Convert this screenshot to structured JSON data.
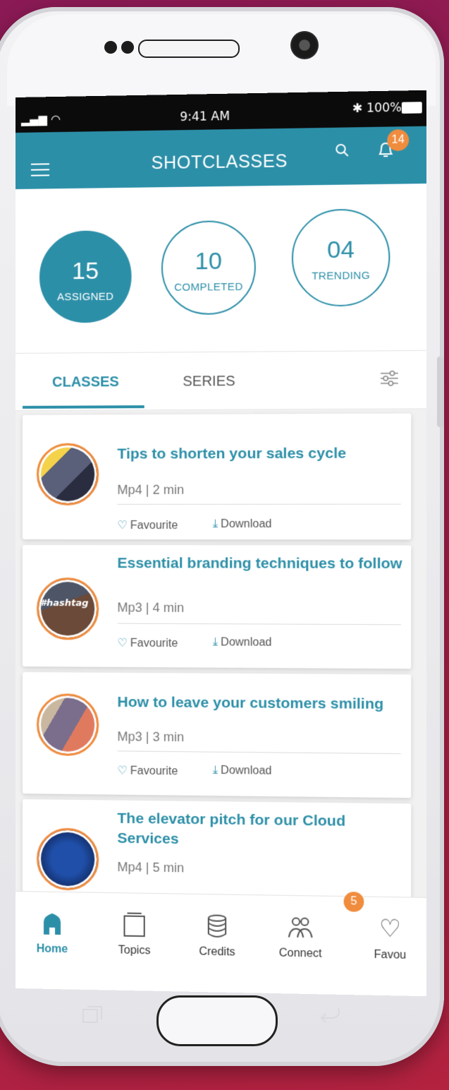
{
  "status": {
    "time": "9:41 AM",
    "battery": "100%"
  },
  "appbar": {
    "title": "SHOTCLASSES",
    "notifications": "14"
  },
  "stats": [
    {
      "value": "15",
      "label": "ASSIGNED"
    },
    {
      "value": "10",
      "label": "COMPLETED"
    },
    {
      "value": "04",
      "label": "TRENDING"
    }
  ],
  "tabs": {
    "classes": "CLASSES",
    "series": "SERIES"
  },
  "cards": [
    {
      "title": "Tips to shorten your sales cycle",
      "meta": "Mp4 | 2 min",
      "fav": "Favourite",
      "download": "Download"
    },
    {
      "title": "Essential branding techniques to follow",
      "meta": "Mp3 | 4 min",
      "fav": "Favourite",
      "download": "Download",
      "thumb_text": "#hashtag"
    },
    {
      "title": "How to leave your customers smiling",
      "meta": "Mp3 | 3 min",
      "fav": "Favourite",
      "download": "Download"
    },
    {
      "title": "The elevator pitch for our Cloud Services",
      "meta": "Mp4 | 5 min"
    }
  ],
  "nav": {
    "home": "Home",
    "topics": "Topics",
    "credits": "Credits",
    "connect": "Connect",
    "favourites": "Favou",
    "connect_badge": "5"
  },
  "colors": {
    "accent": "#2c8fa8",
    "badge": "#f08c3e",
    "background": "#9e1d4a"
  }
}
